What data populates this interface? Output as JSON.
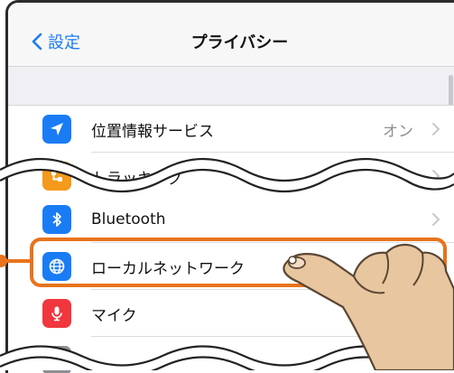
{
  "navbar": {
    "back_label": "設定",
    "title": "プライバシー"
  },
  "rows": [
    {
      "label": "位置情報サービス",
      "value": "オン",
      "icon": "location-arrow-icon",
      "color": "#1a7cf5"
    },
    {
      "label": "トラッキング",
      "value": "",
      "icon": "tracking-icon",
      "color": "#f49a1c"
    },
    {
      "label": "Bluetooth",
      "value": "",
      "icon": "bluetooth-icon",
      "color": "#1a7cf5"
    },
    {
      "label": "ローカルネットワーク",
      "value": "",
      "icon": "globe-icon",
      "color": "#1a7cf5"
    },
    {
      "label": "マイク",
      "value": "",
      "icon": "microphone-icon",
      "color": "#f0373d"
    },
    {
      "label": "",
      "value": "",
      "icon": "speech-icon",
      "color": "#8e8e93"
    }
  ],
  "colors": {
    "accent": "#1a7cf5",
    "highlight": "#e8731b",
    "chevron": "#c7c7cc"
  }
}
